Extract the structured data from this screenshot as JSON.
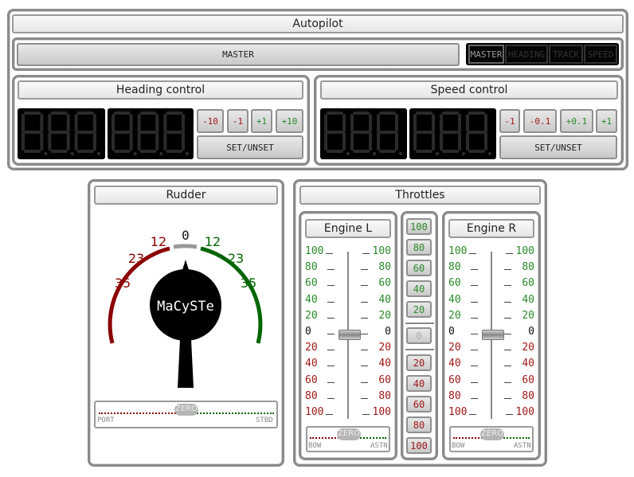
{
  "autopilot": {
    "title": "Autopilot",
    "master_button": "MASTER",
    "modes": [
      {
        "label": "MASTER",
        "active": true
      },
      {
        "label": "HEADING",
        "active": false
      },
      {
        "label": "TRACK",
        "active": false
      },
      {
        "label": "SPEED",
        "active": false
      }
    ]
  },
  "heading": {
    "title": "Heading control",
    "display_left": "888",
    "display_right": "888",
    "buttons": [
      {
        "label": "-10",
        "tone": "red"
      },
      {
        "label": "-1",
        "tone": "red"
      },
      {
        "label": "+1",
        "tone": "green"
      },
      {
        "label": "+10",
        "tone": "green"
      }
    ],
    "set_label": "SET/UNSET"
  },
  "speed": {
    "title": "Speed control",
    "display_left": "888",
    "display_right": "888",
    "buttons": [
      {
        "label": "-1",
        "tone": "red"
      },
      {
        "label": "-0.1",
        "tone": "red"
      },
      {
        "label": "+0.1",
        "tone": "green"
      },
      {
        "label": "+1",
        "tone": "green"
      }
    ],
    "set_label": "SET/UNSET"
  },
  "rudder": {
    "title": "Rudder",
    "port_labels": [
      "12",
      "23",
      "35"
    ],
    "stbd_labels": [
      "12",
      "23",
      "35"
    ],
    "center_label": "0",
    "knob_label": "MaCySTe",
    "angle": 0,
    "trim": {
      "zero_label": "ZERO",
      "left_label": "PORT",
      "right_label": "STBD"
    }
  },
  "throttles": {
    "title": "Throttles",
    "scale": [
      {
        "label": "100",
        "tone": "green"
      },
      {
        "label": "80",
        "tone": "green"
      },
      {
        "label": "60",
        "tone": "green"
      },
      {
        "label": "40",
        "tone": "green"
      },
      {
        "label": "20",
        "tone": "green"
      },
      {
        "label": "0",
        "tone": "black"
      },
      {
        "label": "20",
        "tone": "red"
      },
      {
        "label": "40",
        "tone": "red"
      },
      {
        "label": "60",
        "tone": "red"
      },
      {
        "label": "80",
        "tone": "red"
      },
      {
        "label": "100",
        "tone": "red"
      }
    ],
    "engine_left": {
      "title": "Engine L",
      "value": 0,
      "trim": {
        "zero_label": "ZERO",
        "left_label": "BOW",
        "right_label": "ASTN"
      }
    },
    "engine_right": {
      "title": "Engine R",
      "value": 0,
      "trim": {
        "zero_label": "ZERO",
        "left_label": "BOW",
        "right_label": "ASTN"
      }
    },
    "presets_ahead": [
      "100",
      "80",
      "60",
      "40",
      "20"
    ],
    "preset_zero": "0",
    "presets_astern": [
      "20",
      "40",
      "60",
      "80",
      "100"
    ]
  },
  "colors": {
    "port": "#8b0000",
    "stbd": "#006400",
    "frame": "#8a8a8a"
  }
}
